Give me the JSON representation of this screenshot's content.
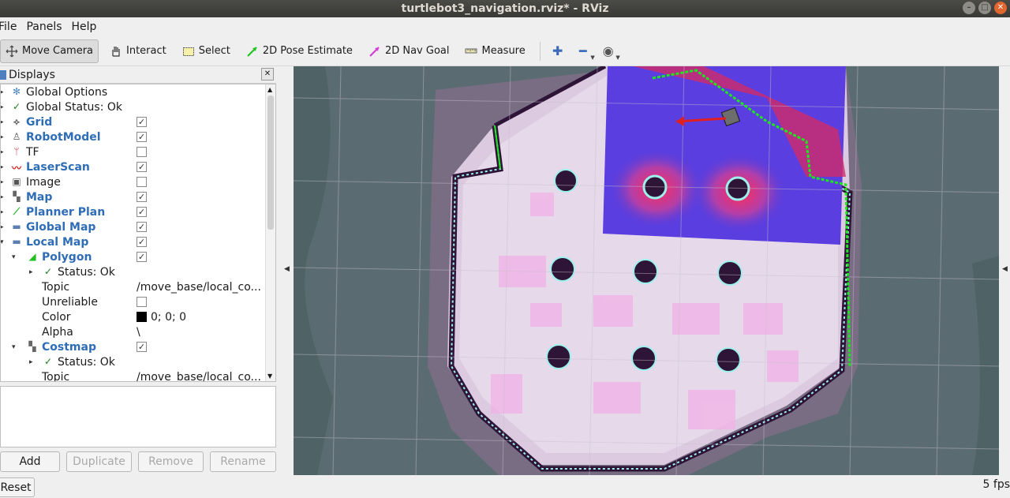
{
  "window": {
    "title": "turtlebot3_navigation.rviz* - RViz"
  },
  "menu": [
    "File",
    "Panels",
    "Help"
  ],
  "toolbar": {
    "tools": [
      "Move Camera",
      "Interact",
      "Select",
      "2D Pose Estimate",
      "2D Nav Goal",
      "Measure"
    ],
    "active_tool": "Move Camera",
    "tool_colors": {
      "pose": "#22c422",
      "goal": "#d43cd4"
    }
  },
  "displays_panel": {
    "title": "Displays",
    "tree": [
      {
        "label": "Global Options",
        "icon": "gear-icon"
      },
      {
        "label": "Global Status: Ok",
        "icon": "check-icon"
      },
      {
        "label": "Grid",
        "icon": "grid-icon",
        "checked": true
      },
      {
        "label": "RobotModel",
        "icon": "robot-icon",
        "checked": true
      },
      {
        "label": "TF",
        "icon": "tf-icon",
        "checked": false
      },
      {
        "label": "LaserScan",
        "icon": "laser-icon",
        "checked": true
      },
      {
        "label": "Image",
        "icon": "image-icon",
        "checked": false
      },
      {
        "label": "Map",
        "icon": "map-icon",
        "checked": true
      },
      {
        "label": "Planner Plan",
        "icon": "path-icon",
        "checked": true
      },
      {
        "label": "Global Map",
        "icon": "folder-icon",
        "checked": true
      },
      {
        "label": "Local Map",
        "icon": "folder-icon",
        "checked": true
      },
      {
        "label": "Polygon",
        "icon": "polygon-icon",
        "checked": true
      },
      {
        "label": "Status: Ok",
        "icon": "check-icon"
      },
      {
        "label": "Topic",
        "value": "/move_base/local_co..."
      },
      {
        "label": "Unreliable",
        "checked": false
      },
      {
        "label": "Color",
        "value": "0; 0; 0"
      },
      {
        "label": "Alpha",
        "value": "\\"
      },
      {
        "label": "Costmap",
        "icon": "map-icon",
        "checked": true
      },
      {
        "label": "Status: Ok",
        "icon": "check-icon"
      },
      {
        "label": "Topic",
        "value": "/move_base/local_co..."
      }
    ],
    "buttons": [
      "Add",
      "Duplicate",
      "Remove",
      "Rename"
    ]
  },
  "reset_button": "Reset",
  "status": {
    "fps": "5 fps"
  }
}
